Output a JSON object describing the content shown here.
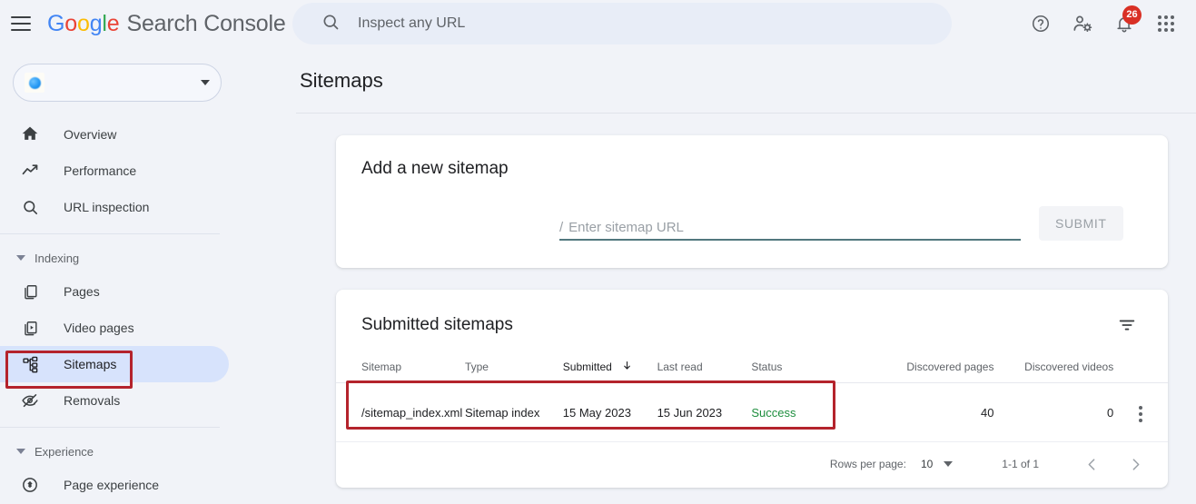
{
  "header": {
    "menu_icon": "hamburger-icon",
    "brand_google": "Google",
    "brand_product": "Search Console",
    "search_placeholder": "Inspect any URL",
    "search_value": "",
    "search_icon": "search-icon",
    "help_icon": "help-circle-icon",
    "accounts_icon": "user-settings-icon",
    "notifications_icon": "bell-icon",
    "notifications_count": "26",
    "apps_icon": "apps-grid-icon"
  },
  "sidebar": {
    "property_selector": {
      "name": "",
      "favicon": "site-favicon-icon",
      "caret": "chevron-down-icon"
    },
    "items": [
      {
        "label": "Overview",
        "icon": "home-icon",
        "active": false
      },
      {
        "label": "Performance",
        "icon": "trending-up-icon",
        "active": false
      },
      {
        "label": "URL inspection",
        "icon": "search-icon",
        "active": false
      }
    ],
    "sections": [
      {
        "label": "Indexing",
        "caret": "caret-down-icon",
        "items": [
          {
            "label": "Pages",
            "icon": "pages-copy-icon",
            "active": false
          },
          {
            "label": "Video pages",
            "icon": "video-pages-icon",
            "active": false
          },
          {
            "label": "Sitemaps",
            "icon": "account-tree-icon",
            "active": true
          },
          {
            "label": "Removals",
            "icon": "eye-off-icon",
            "active": false
          }
        ]
      },
      {
        "label": "Experience",
        "caret": "caret-down-icon",
        "items": [
          {
            "label": "Page experience",
            "icon": "page-experience-icon",
            "active": false
          }
        ]
      }
    ]
  },
  "main": {
    "page_title": "Sitemaps",
    "add_sitemap": {
      "title": "Add a new sitemap",
      "url_prefix": "/",
      "url_placeholder": "Enter sitemap URL",
      "url_value": "",
      "submit_label": "SUBMIT"
    },
    "submitted": {
      "title": "Submitted sitemaps",
      "filter_icon": "filter-icon",
      "columns": [
        {
          "label": "Sitemap",
          "sorted": false,
          "numeric": false
        },
        {
          "label": "Type",
          "sorted": false,
          "numeric": false
        },
        {
          "label": "Submitted",
          "sorted": true,
          "numeric": false,
          "sort_icon": "arrow-down-icon"
        },
        {
          "label": "Last read",
          "sorted": false,
          "numeric": false
        },
        {
          "label": "Status",
          "sorted": false,
          "numeric": false
        },
        {
          "label": "Discovered pages",
          "sorted": false,
          "numeric": true
        },
        {
          "label": "Discovered videos",
          "sorted": false,
          "numeric": true
        }
      ],
      "rows": [
        {
          "sitemap": "/sitemap_index.xml",
          "type": "Sitemap index",
          "submitted": "15 May 2023",
          "last_read": "15 Jun 2023",
          "status": "Success",
          "discovered_pages": "40",
          "discovered_videos": "0",
          "menu_icon": "more-vert-icon"
        }
      ],
      "footer": {
        "rows_per_page_label": "Rows per page:",
        "rows_per_page_value": "10",
        "rows_per_page_caret": "chevron-down-icon",
        "range": "1-1 of 1",
        "prev_icon": "chevron-left-icon",
        "next_icon": "chevron-right-icon"
      }
    }
  },
  "annotations": {
    "accent_color": "#b4232c",
    "boxes": [
      {
        "name": "sitemaps-nav-highlight"
      },
      {
        "name": "sitemap-row-highlight"
      }
    ]
  },
  "colors": {
    "background": "#f1f3f8",
    "card": "#ffffff",
    "active_nav": "#d7e3fc",
    "success": "#1e8e3e",
    "badge": "#d93025",
    "input_underline": "#52787e"
  }
}
